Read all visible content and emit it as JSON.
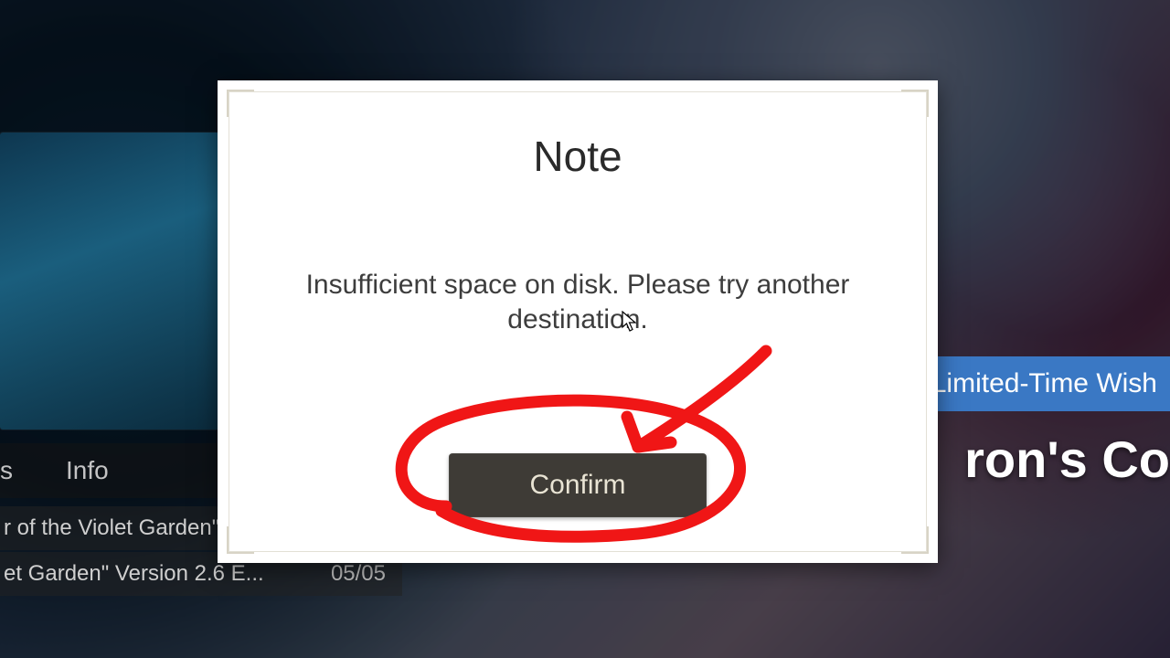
{
  "background": {
    "tabs": {
      "first_partial": "s",
      "info": "Info"
    },
    "headlines": [
      {
        "text": "r of the Violet Garden\"",
        "date": ""
      },
      {
        "text": "et Garden\" Version 2.6 E...",
        "date": "05/05"
      }
    ],
    "banner": {
      "strip": "- New Limited-Time Wish",
      "title_fragment": "ron's Co"
    }
  },
  "dialog": {
    "title": "Note",
    "message": "Insufficient space on disk. Please try another destination.",
    "confirm_label": "Confirm"
  },
  "annotation": {
    "color": "#f01616"
  }
}
